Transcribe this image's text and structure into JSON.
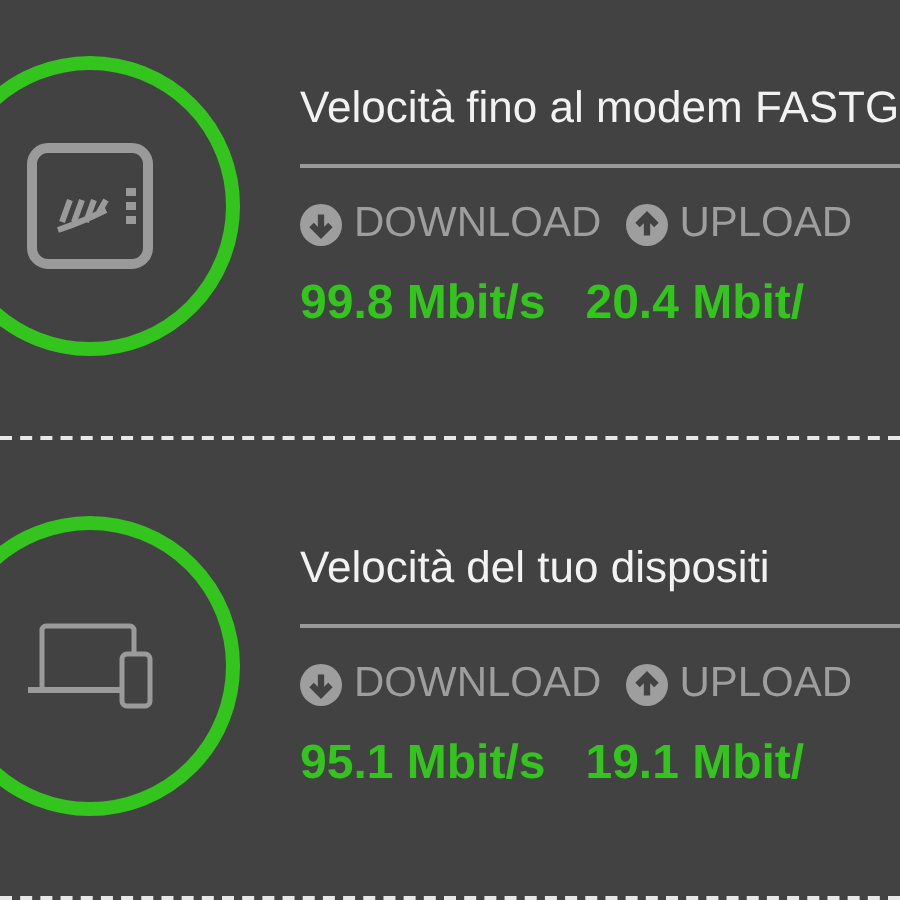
{
  "sections": [
    {
      "kind": "modem",
      "title": "Velocità fino al modem FASTG",
      "download_label": "DOWNLOAD",
      "upload_label": "UPLOAD",
      "download_value": "99.8 Mbit/s",
      "upload_value": "20.4 Mbit/"
    },
    {
      "kind": "device",
      "title": "Velocità del tuo dispositi",
      "download_label": "DOWNLOAD",
      "upload_label": "UPLOAD",
      "download_value": "95.1 Mbit/s",
      "upload_value": "19.1 Mbit/"
    }
  ]
}
